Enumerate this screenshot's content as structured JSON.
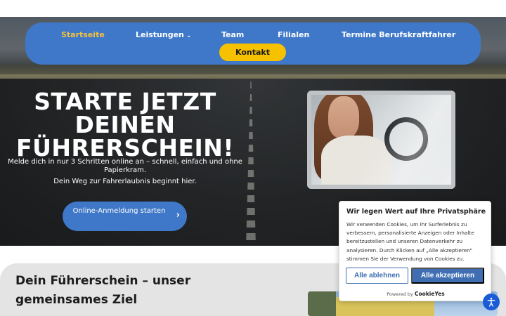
{
  "nav": {
    "items": [
      {
        "label": "Startseite",
        "active": true
      },
      {
        "label": "Leistungen",
        "dropdown": true
      },
      {
        "label": "Team"
      },
      {
        "label": "Filialen"
      },
      {
        "label": "Termine Berufskraftfahrer"
      }
    ],
    "contact_label": "Kontakt"
  },
  "hero": {
    "headline_line1": "STARTE JETZT",
    "headline_line2": "DEINEN",
    "headline_line3": "FÜHRERSCHEIN!",
    "subtitle": "Melde dich in nur 3 Schritten online an – schnell, einfach und ohne Papierkram.",
    "tagline": "Dein Weg zur Fahrerlaubnis beginnt hier.",
    "cta_label": "Online-Anmeldung starten",
    "cta_arrow": "›"
  },
  "section2": {
    "title": "Dein Führerschein – unser gemeinsames Ziel"
  },
  "cookie_banner": {
    "title": "Wir legen Wert auf Ihre Privatsphäre",
    "text": "Wir verwenden Cookies, um Ihr Surferlebnis zu verbessern, personalisierte Anzeigen oder Inhalte bereitzustellen und unseren Datenverkehr zu analysieren. Durch Klicken auf „Alle akzeptieren“ stimmen Sie der Verwendung von Cookies zu.",
    "reject_label": "Alle ablehnen",
    "accept_label": "Alle akzeptieren",
    "powered_prefix": "Powered by",
    "powered_brand": "CookieYes"
  },
  "colors": {
    "brand_blue": "#3f78c8",
    "accent_yellow": "#f6c100",
    "cookie_blue": "#3f6eb3",
    "accessibility_blue": "#1a5bd6"
  },
  "icons": {
    "dropdown": "chevron-down-icon",
    "cta": "chevron-right-icon",
    "accessibility": "accessibility-icon"
  }
}
